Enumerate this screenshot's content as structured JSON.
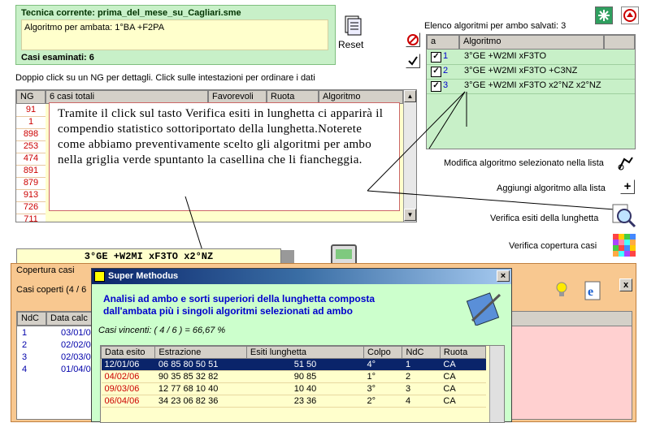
{
  "current_technique": {
    "title": "Tecnica corrente: prima_del_mese_su_Cagliari.sme",
    "ambata_line": "Algoritmo per ambata: 1°BA +F2PA",
    "cases_examined": "Casi esaminati: 6"
  },
  "reset_label": "Reset",
  "saved_algorithms": {
    "header": "Elenco algoritmi per ambo salvati: 3",
    "col_a": "a",
    "col_algorithm": "Algoritmo",
    "rows": [
      {
        "n": "1",
        "algo": "3°GE +W2MI xF3TO"
      },
      {
        "n": "2",
        "algo": "3°GE +W2MI xF3TO +C3NZ"
      },
      {
        "n": "3",
        "algo": "3°GE +W2MI xF3TO x2°NZ x2°NZ"
      }
    ]
  },
  "hint_text": "Doppio click su un NG per dettagli. Click sulle intestazioni per ordinare i dati",
  "main_grid": {
    "headers": [
      "NG",
      "6 casi totali",
      "Favorevoli",
      "Ruota",
      "Algoritmo"
    ],
    "ng_values": [
      "91",
      "1",
      "898",
      "253",
      "474",
      "891",
      "879",
      "913",
      "726",
      "711"
    ]
  },
  "annotation": "Tramite il click sul tasto Verifica esiti in lunghetta ci apparirà il compendio statistico sottoriportato della lunghetta.Noterete come abbiamo preventivamente scelto gli algoritmi per ambo nella griglia verde spuntanto la casellina che li fiancheggia.",
  "actions": {
    "modify": "Modifica algoritmo selezionato nella lista",
    "add": "Aggiungi algoritmo alla lista",
    "verify_outcomes": "Verifica esiti della lunghetta",
    "verify_coverage": "Verifica copertura casi"
  },
  "formula_display": "3°GE +W2MI xF3TO x2°NZ",
  "coverage_panel": {
    "title": "Copertura casi",
    "covered_label": "Casi coperti (4 / 6",
    "col_ndc": "NdC",
    "col_date": "Data calc",
    "rows": [
      {
        "ndc": "1",
        "date": "03/01/0"
      },
      {
        "ndc": "2",
        "date": "02/02/0"
      },
      {
        "ndc": "3",
        "date": "02/03/0"
      },
      {
        "ndc": "4",
        "date": "01/04/0"
      }
    ]
  },
  "dialog": {
    "title": "Super Methodus",
    "heading_line1": "Analisi ad ambo e sorti superiori della lunghetta composta",
    "heading_line2": "dall'ambata più i singoli algoritmi selezionati ad ambo",
    "winning_cases": "Casi vincenti: ( 4 / 6 ) = 66,67 %",
    "columns": [
      "Data esito",
      "Estrazione",
      "Esiti lunghetta",
      "Colpo",
      "NdC",
      "Ruota"
    ],
    "rows": [
      {
        "date": "12/01/06",
        "draw": "06 85 80 50 51",
        "result": "51 50",
        "colpo": "4°",
        "ndc": "1",
        "ruota": "CA"
      },
      {
        "date": "04/02/06",
        "draw": "90 35 85 32 82",
        "result": "90 85",
        "colpo": "1°",
        "ndc": "2",
        "ruota": "CA"
      },
      {
        "date": "09/03/06",
        "draw": "12 77 68 10 40",
        "result": "10 40",
        "colpo": "3°",
        "ndc": "3",
        "ruota": "CA"
      },
      {
        "date": "06/04/06",
        "draw": "34 23 06 82 36",
        "result": "23 36",
        "colpo": "2°",
        "ndc": "4",
        "ruota": "CA"
      }
    ]
  },
  "colors": {
    "green_panel": "#c8f0c8",
    "yellow_box": "#ffffcc",
    "dialog_title_bar": "#0a246a",
    "dialog_heading": "#0000cc",
    "coverage_panel": "#f8c890",
    "selected_row": "#0a246a",
    "row_date_red": "#cc0000",
    "ng_red": "#cc0000"
  }
}
